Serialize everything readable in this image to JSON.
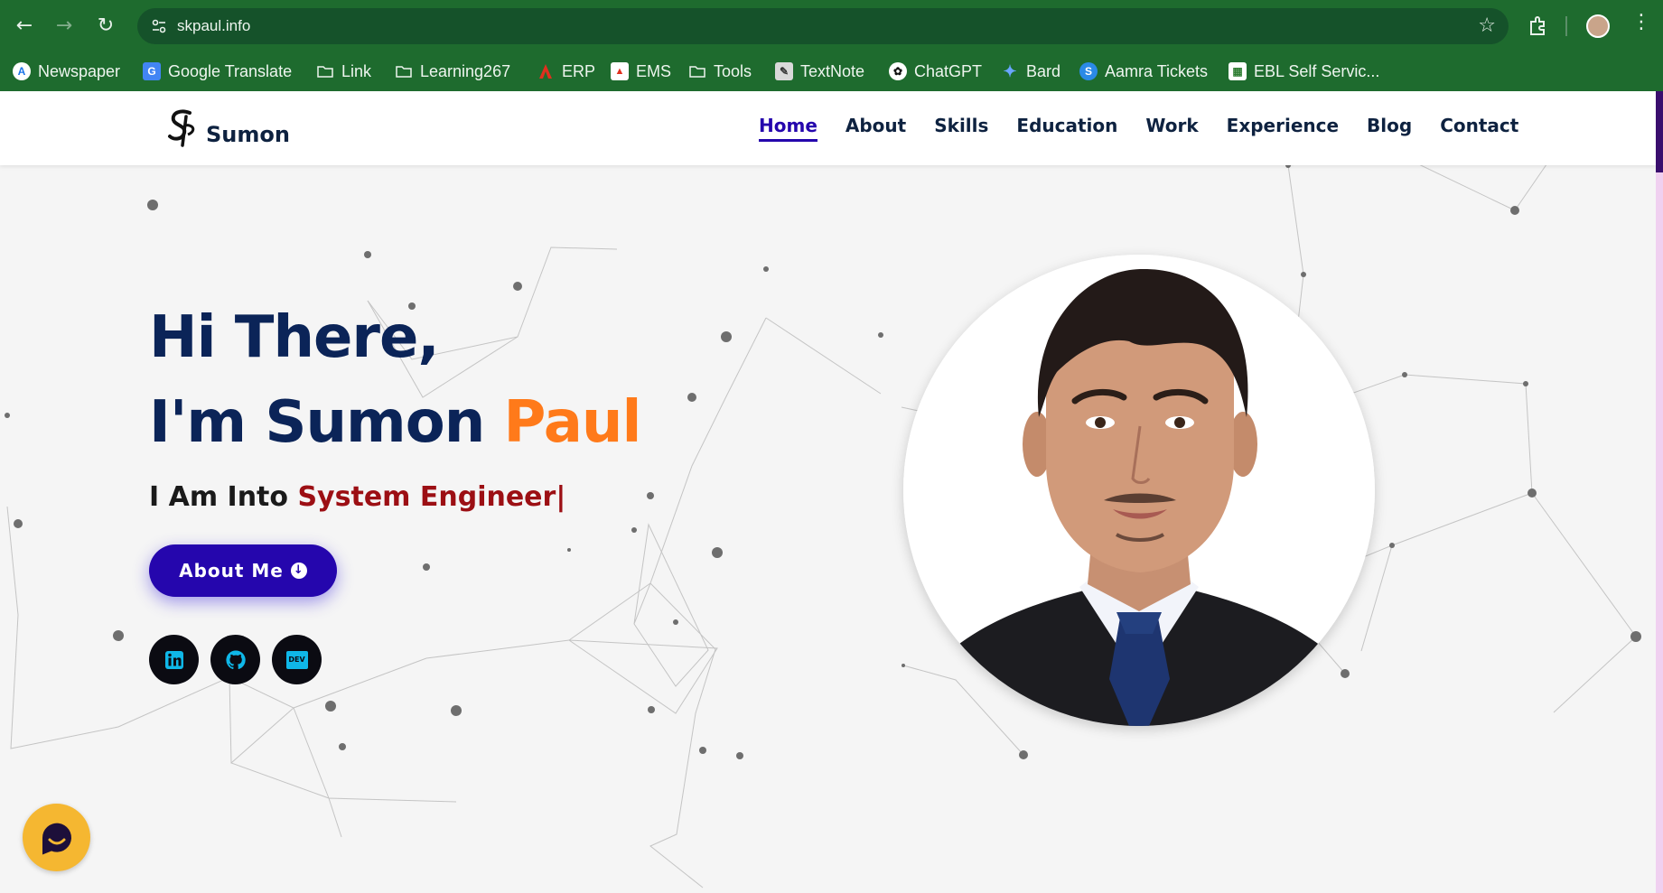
{
  "browser": {
    "url": "skpaul.info",
    "bookmarks": [
      {
        "label": "Newspaper",
        "icon": "newspaper-icon"
      },
      {
        "label": "Google Translate",
        "icon": "translate-icon"
      },
      {
        "label": "Link",
        "icon": "folder-icon"
      },
      {
        "label": "Learning267",
        "icon": "folder-icon"
      },
      {
        "label": "ERP",
        "icon": "erp-icon"
      },
      {
        "label": "EMS",
        "icon": "ems-icon"
      },
      {
        "label": "Tools",
        "icon": "folder-icon"
      },
      {
        "label": "TextNote",
        "icon": "note-icon"
      },
      {
        "label": "ChatGPT",
        "icon": "chatgpt-icon"
      },
      {
        "label": "Bard",
        "icon": "sparkle-icon"
      },
      {
        "label": "Aamra Tickets",
        "icon": "aamra-icon"
      },
      {
        "label": "EBL Self Servic...",
        "icon": "ebl-icon"
      }
    ]
  },
  "site": {
    "logo_text": "Sumon",
    "nav": [
      {
        "label": "Home",
        "active": true
      },
      {
        "label": "About",
        "active": false
      },
      {
        "label": "Skills",
        "active": false
      },
      {
        "label": "Education",
        "active": false
      },
      {
        "label": "Work",
        "active": false
      },
      {
        "label": "Experience",
        "active": false
      },
      {
        "label": "Blog",
        "active": false
      },
      {
        "label": "Contact",
        "active": false
      }
    ]
  },
  "hero": {
    "greeting": "Hi There,",
    "name_prefix": "I'm Sumon ",
    "name_accent": "Paul",
    "subtitle_prefix": "I Am Into ",
    "subtitle_typed": "System Engineer",
    "cursor": "|",
    "cta_label": "About Me",
    "socials": [
      {
        "name": "linkedin",
        "icon": "linkedin-icon"
      },
      {
        "name": "github",
        "icon": "github-icon"
      },
      {
        "name": "dev",
        "icon": "dev-icon",
        "text": "DEV"
      }
    ]
  },
  "colors": {
    "browser_green": "#1e6b2e",
    "heading_navy": "#0b2458",
    "accent_orange": "#ff7a1a",
    "typed_red": "#9c0f14",
    "primary_button": "#2506ad",
    "chat_yellow": "#f5b731",
    "social_icon": "#0fb7e8"
  }
}
